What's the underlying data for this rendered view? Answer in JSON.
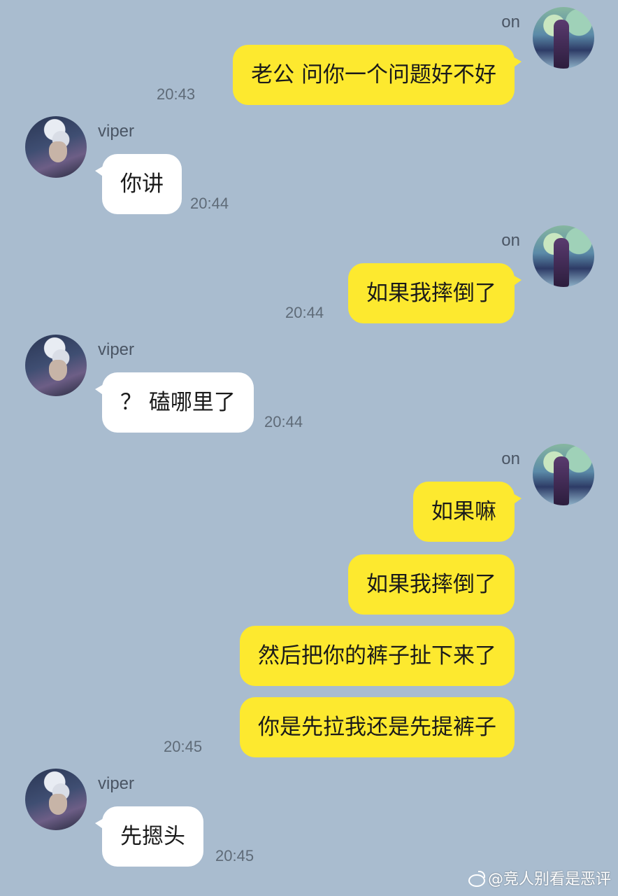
{
  "messages": [
    {
      "sender": "on",
      "text": "老公 问你一个问题好不好",
      "time": "20:43"
    },
    {
      "sender": "viper",
      "text": "你讲",
      "time": "20:44"
    },
    {
      "sender": "on",
      "text": "如果我摔倒了",
      "time": "20:44"
    },
    {
      "sender": "viper",
      "text": "？ 磕哪里了",
      "time": "20:44"
    },
    {
      "sender": "on",
      "text": "如果嘛"
    },
    {
      "sender": "on",
      "text": "如果我摔倒了"
    },
    {
      "sender": "on",
      "text": "然后把你的裤子扯下来了"
    },
    {
      "sender": "on",
      "text": "你是先拉我还是先提裤子",
      "time": "20:45"
    },
    {
      "sender": "viper",
      "text": "先摁头",
      "time": "20:45"
    }
  ],
  "watermark": "@竞人别看是恶评",
  "colors": {
    "background": "#a9bccf",
    "my_bubble": "#fde92f",
    "their_bubble": "#ffffff"
  }
}
